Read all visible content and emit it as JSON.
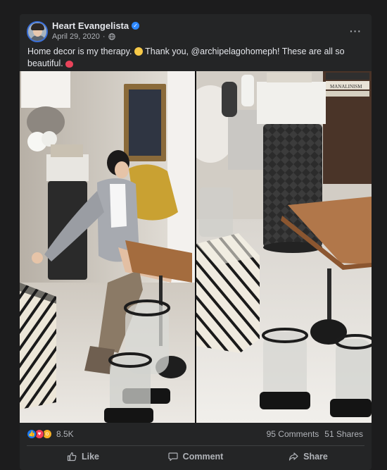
{
  "post": {
    "author": "Heart Evangelista",
    "date": "April 29, 2020",
    "separator": "·",
    "caption_part1": "Home decor is my therapy.",
    "caption_part2": "Thank you, @archipelagohomeph! These are all so beautiful.",
    "more_label": "···",
    "verified_mark": "✓"
  },
  "photo_labels": {
    "book": "MANALINISM"
  },
  "stats": {
    "reaction_count": "8.5K",
    "comments": "95 Comments",
    "shares": "51 Shares"
  },
  "actions": {
    "like": "Like",
    "comment": "Comment",
    "share": "Share"
  },
  "colors": {
    "card_bg": "#242526",
    "page_bg": "#1c1c1d",
    "verified": "#2d88ff",
    "like": "#1877f2",
    "love": "#f33e58",
    "wow": "#f7b125"
  },
  "icons": [
    "verified-badge-icon",
    "globe-icon",
    "more-options-icon",
    "like-reaction-icon",
    "love-reaction-icon",
    "wow-reaction-icon",
    "thumbs-up-icon",
    "comment-icon",
    "share-icon"
  ]
}
